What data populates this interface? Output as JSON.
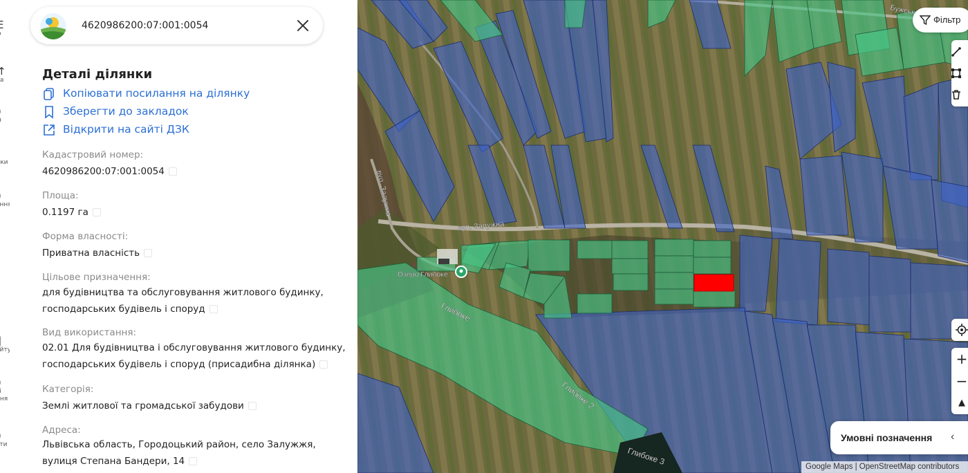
{
  "rail": {
    "items": [
      {
        "icon": "E",
        "label": "ю"
      },
      {
        "icon": "↑",
        "label": "на"
      },
      {
        "icon": ")",
        "label": "ія"
      },
      {
        "icon": "|",
        "label": "дки"
      },
      {
        "icon": ")",
        "label": "ення"
      },
      {
        "icon": "",
        "label": "д"
      },
      {
        "icon": "]",
        "label": "айту"
      },
      {
        "icon": ")",
        "label": "ті\nння"
      },
      {
        "icon": ")",
        "label": "кти"
      }
    ]
  },
  "search": {
    "value": "4620986200:07:001:0054",
    "logo_icon": "dzk-logo-icon",
    "close_icon": "close-icon"
  },
  "details": {
    "title": "Деталі ділянки",
    "actions": [
      {
        "icon": "copy-link-icon",
        "label": "Копіювати посилання на ділянку"
      },
      {
        "icon": "bookmark-icon",
        "label": "Зберегти до закладок"
      },
      {
        "icon": "external-link-icon",
        "label": "Відкрити на сайті ДЗК"
      }
    ],
    "fields": [
      {
        "label": "Кадастровий номер:",
        "value": "4620986200:07:001:0054"
      },
      {
        "label": "Площа:",
        "value": "0.1197 га"
      },
      {
        "label": "Форма власності:",
        "value": "Приватна власність"
      },
      {
        "label": "Цільове призначення:",
        "value": "для будівництва та обслуговування житлового будинку, господарських будівель і споруд"
      },
      {
        "label": "Вид використання:",
        "value": "02.01 Для будівництва і обслуговування житлового будинку, господарських будівель і споруд (присадибна ділянка)"
      },
      {
        "label": "Категорія:",
        "value": "Землі житлової та громадської забудови"
      },
      {
        "label": "Адреса:",
        "value": "Львівська область, Городоцький район, село Залужжя, вулиця Степана Бандери, 14"
      }
    ]
  },
  "map": {
    "filter_label": "Фільтр",
    "legend_label": "Умовні позначення",
    "attribution": "Google Maps | OpenStreetMap contributors",
    "labels": {
      "street_1": "вул. Залужна",
      "street_2": "вул. Залужна",
      "lake_1": "Глибоке",
      "lake_2": "Глибоке 2",
      "lake_3": "Глибоке 3",
      "poi": "Озеро Глибоке",
      "top_street": "Бужська"
    },
    "colors": {
      "private_parcel": "#3a5fc8",
      "communal_parcel": "#3fbf7f",
      "selected_parcel": "#ff0000"
    },
    "controls": {
      "zoom_in": "+",
      "zoom_out": "−",
      "compass": "▲"
    }
  }
}
